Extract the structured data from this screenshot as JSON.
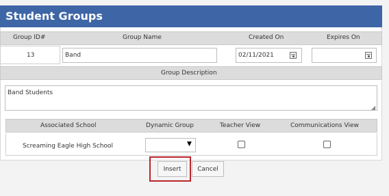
{
  "title": "Student Groups",
  "headers": {
    "group_id": "Group ID#",
    "group_name": "Group Name",
    "created_on": "Created On",
    "expires_on": "Expires On"
  },
  "row": {
    "group_id": "13",
    "group_name": "Band",
    "created_on": "02/11/2021",
    "expires_on": ""
  },
  "description": {
    "label": "Group Description",
    "value": "Band Students"
  },
  "school_table": {
    "headers": [
      "Associated School",
      "Dynamic Group",
      "Teacher View",
      "Communications View"
    ],
    "row": {
      "school": "Screaming Eagle High School",
      "dynamic_group_selected": "",
      "teacher_view": false,
      "communications_view": false
    }
  },
  "buttons": {
    "insert": "Insert",
    "cancel": "Cancel"
  },
  "colors": {
    "titlebar": "#3e66a6",
    "highlight": "#b8262b"
  }
}
